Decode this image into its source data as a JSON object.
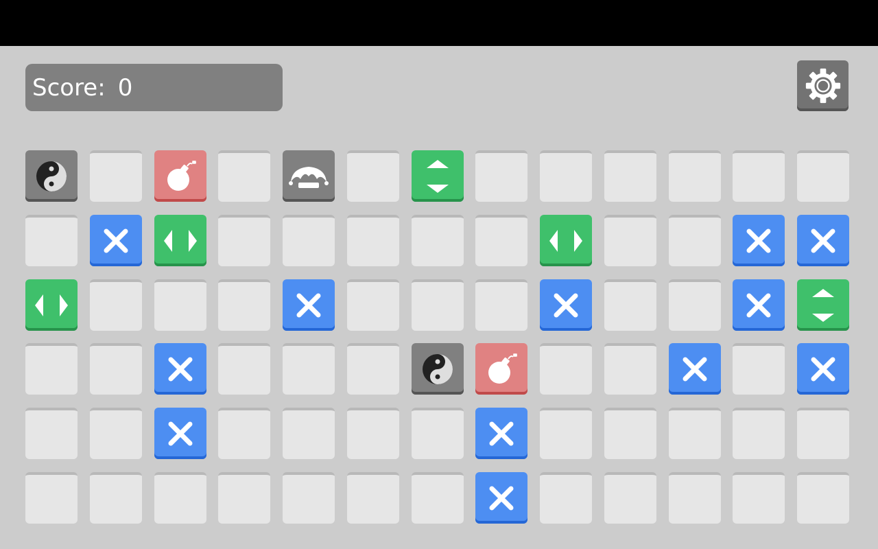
{
  "score": {
    "label": "Score:",
    "value": "0"
  },
  "settings": {
    "icon": "gear-icon"
  },
  "colors": {
    "background": "#cccccc",
    "empty_tile": "#e6e6e6",
    "x_tile": "#4d8ef2",
    "arrow_tile": "#3fc06b",
    "bomb_tile": "#e08282",
    "special_tile": "#808080"
  },
  "grid": {
    "columns": 13,
    "rows": [
      [
        "yinyang",
        "empty",
        "bomb",
        "empty",
        "jester",
        "empty",
        "arrows-vertical",
        "empty",
        "empty",
        "empty",
        "empty",
        "empty",
        "empty"
      ],
      [
        "empty",
        "x",
        "arrows-horizontal",
        "empty",
        "empty",
        "empty",
        "empty",
        "empty",
        "arrows-horizontal",
        "empty",
        "empty",
        "x",
        "x"
      ],
      [
        "arrows-horizontal",
        "empty",
        "empty",
        "empty",
        "x",
        "empty",
        "empty",
        "empty",
        "x",
        "empty",
        "empty",
        "x",
        "arrows-vertical"
      ],
      [
        "empty",
        "empty",
        "x",
        "empty",
        "empty",
        "empty",
        "yinyang",
        "bomb",
        "empty",
        "empty",
        "x",
        "empty",
        "x"
      ],
      [
        "empty",
        "empty",
        "x",
        "empty",
        "empty",
        "empty",
        "empty",
        "x",
        "empty",
        "empty",
        "empty",
        "empty",
        "empty"
      ],
      [
        "empty",
        "empty",
        "empty",
        "empty",
        "empty",
        "empty",
        "empty",
        "x",
        "empty",
        "empty",
        "empty",
        "empty",
        "empty"
      ]
    ]
  }
}
